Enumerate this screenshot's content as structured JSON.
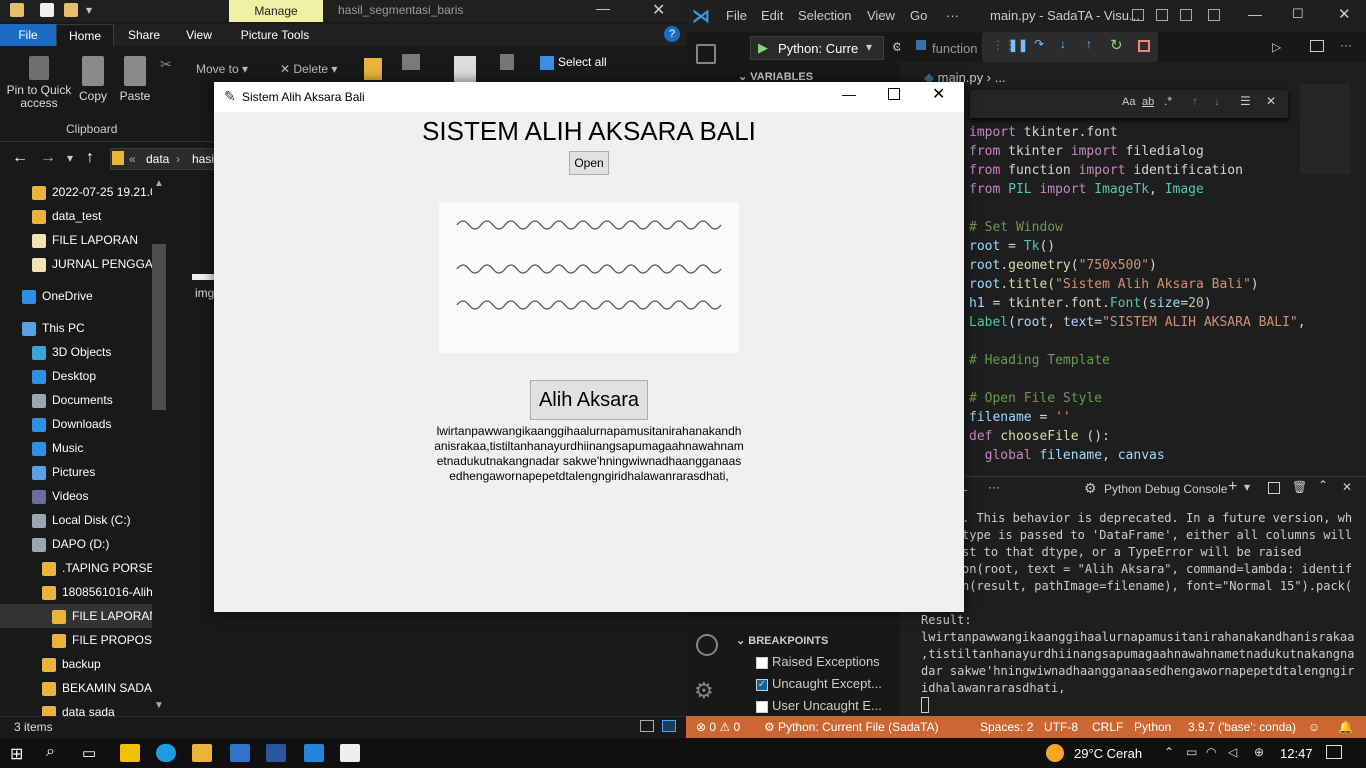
{
  "explorer": {
    "manage_tab": "Manage",
    "window_title": "hasil_segmentasi_baris",
    "tabs": [
      "File",
      "Home",
      "Share",
      "View",
      "Picture Tools"
    ],
    "clipboard": {
      "pin": "Pin to Quick access",
      "copy": "Copy",
      "paste": "Paste",
      "group": "Clipboard"
    },
    "organize": {
      "move_to": "Move to",
      "delete": "Delete"
    },
    "select_all": "Select all",
    "path": [
      "data",
      "hasi"
    ],
    "nav_items": [
      {
        "label": "2022-07-25 19.21.0",
        "icon": "folder-icon"
      },
      {
        "label": "data_test",
        "icon": "folder-icon"
      },
      {
        "label": "FILE LAPORAN",
        "icon": "document-icon"
      },
      {
        "label": "JURNAL PENGGAN",
        "icon": "document-icon"
      },
      {
        "label": "OneDrive",
        "icon": "cloud-icon"
      },
      {
        "label": "This PC",
        "icon": "computer-icon"
      },
      {
        "label": "3D Objects",
        "icon": "cube-icon"
      },
      {
        "label": "Desktop",
        "icon": "desktop-icon"
      },
      {
        "label": "Documents",
        "icon": "documents-icon"
      },
      {
        "label": "Downloads",
        "icon": "download-icon"
      },
      {
        "label": "Music",
        "icon": "music-icon"
      },
      {
        "label": "Pictures",
        "icon": "pictures-icon"
      },
      {
        "label": "Videos",
        "icon": "videos-icon"
      },
      {
        "label": "Local Disk (C:)",
        "icon": "disk-icon"
      },
      {
        "label": "DAPO (D:)",
        "icon": "disk-icon"
      },
      {
        "label": ".TAPING PORSEN",
        "icon": "folder-icon"
      },
      {
        "label": "1808561016-Aliha",
        "icon": "folder-icon"
      },
      {
        "label": "FILE LAPORAN",
        "icon": "folder-icon"
      },
      {
        "label": "FILE PROPOSAL",
        "icon": "folder-icon"
      },
      {
        "label": "backup",
        "icon": "folder-icon"
      },
      {
        "label": "BEKAMIN SADA",
        "icon": "folder-icon"
      },
      {
        "label": "data sada",
        "icon": "folder-icon"
      }
    ],
    "file_label": "img",
    "status": "3 items"
  },
  "vscode": {
    "menu": [
      "File",
      "Edit",
      "Selection",
      "View",
      "Go",
      "···"
    ],
    "title": "main.py - SadaTA - Visu...",
    "run_config": "Python: Curre",
    "tab_fn": "function",
    "variables": "VARIABLES",
    "breadcrumb": "main.py",
    "code": [
      {
        "t": "import tkinter.font"
      },
      {
        "t": "from tkinter import filedialog"
      },
      {
        "t": "from function import identification"
      },
      {
        "t": "from PIL import ImageTk, Image"
      },
      {
        "t": ""
      },
      {
        "t": "# Set Window"
      },
      {
        "t": "root = Tk()"
      },
      {
        "t": "root.geometry(\"750x500\")"
      },
      {
        "t": "root.title(\"Sistem Alih Aksara Bali\")"
      },
      {
        "t": "h1 = tkinter.font.Font(size=20)"
      },
      {
        "t": "Label(root, text=\"SISTEM ALIH AKSARA BALI\","
      },
      {
        "t": ""
      },
      {
        "t": "# Heading Template"
      },
      {
        "t": ""
      },
      {
        "t": "# Open File Style"
      },
      {
        "t": "filename = ''"
      },
      {
        "t": "def chooseFile ():"
      },
      {
        "t": "  global filename, canvas"
      }
    ],
    "panel_tab": "AL",
    "debug_console": "Python Debug Console",
    "terminal": [
      ". This behavior is deprecated. In a future version, wh",
      "type is passed to 'DataFrame', either all columns will",
      "st to that dtype, or a TypeError will be raised",
      "on(root, text = \"Alih Aksara\", command=lambda: identif",
      "n(result, pathImage=filename), font=\"Normal 15\").pack(",
      "",
      "Result:",
      "lwirtanpawwangikaanggihaalurnapamusitanirahanakandhanisrakaa",
      ",tistiltanhanayurdhiinangsapumagaahnawahnametnadukutnakangna",
      "dar sakwe'hningwiwnadhaangganaasedhengawornapepetdtalengngir",
      "idhalawanrarasdhati,"
    ],
    "breakpoints": "BREAKPOINTS",
    "bp_items": [
      {
        "label": "Raised Exceptions",
        "checked": false
      },
      {
        "label": "Uncaught Except...",
        "checked": true
      },
      {
        "label": "User Uncaught E...",
        "checked": false
      }
    ],
    "status": {
      "errors": "0",
      "warnings": "0",
      "run": "Python: Current File (SadaTA)",
      "spaces": "Spaces: 2",
      "enc": "UTF-8",
      "eol": "CRLF",
      "lang": "Python",
      "interp": "3.9.7 ('base': conda)"
    }
  },
  "tk": {
    "title": "Sistem Alih Aksara Bali",
    "heading": "SISTEM ALIH AKSARA BALI",
    "open_label": "Open",
    "button_label": "Alih Aksara",
    "result": "lwirtanpawwangikaanggihaalurnapamusitanirahanakandhanisrakaa,tistiltanhanayurdhiinangsapumagaahnawahnametnadukutnakangnadar sakwe'hningwiwnadhaangganaasedhengawornapepetdtalengngiridhalawanrarasdhati,"
  },
  "taskbar": {
    "weather": "29°C Cerah",
    "time": "12:47"
  },
  "colors": {
    "vs_status": "#cc6633",
    "explorer_file_tab": "#1c6bc4",
    "manage_tab": "#f1f1a6"
  }
}
